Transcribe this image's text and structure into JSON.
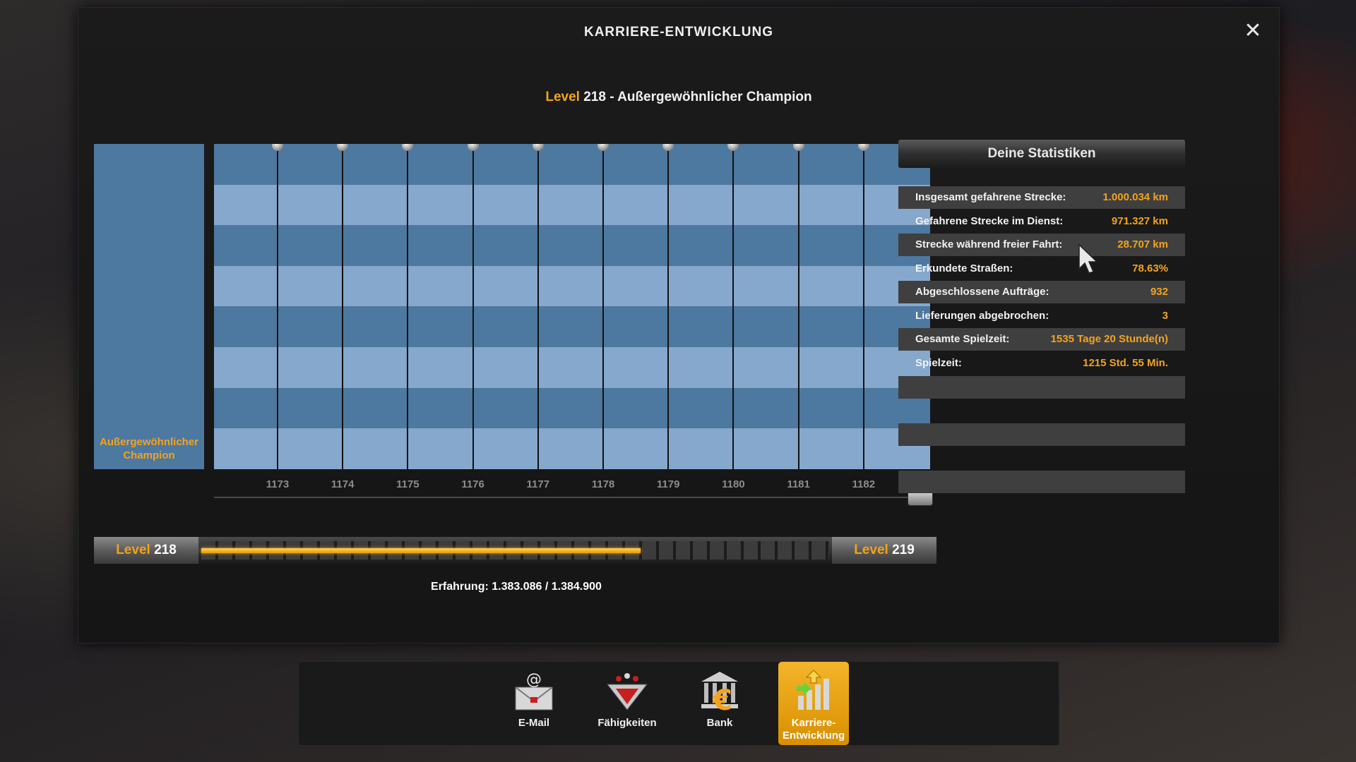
{
  "window": {
    "title": "KARRIERE-ENTWICKLUNG",
    "close_symbol": "✕"
  },
  "heading": {
    "level_word": "Level",
    "level_rest": " 218 - Außergewöhnlicher Champion"
  },
  "rank": {
    "label": "Außergewöhnlicher Champion"
  },
  "timeline": {
    "ticks": [
      "1173",
      "1174",
      "1175",
      "1176",
      "1177",
      "1178",
      "1179",
      "1180",
      "1181",
      "1182"
    ]
  },
  "xp_bar": {
    "left_level_word": "Level",
    "left_level_num": " 218",
    "right_level_word": "Level",
    "right_level_num": " 219",
    "progress": 0.7,
    "text": "Erfahrung: 1.383.086 / 1.384.900"
  },
  "stats": {
    "header": "Deine Statistiken",
    "rows": [
      {
        "label": "Insgesamt gefahrene Strecke:",
        "value": "1.000.034 km"
      },
      {
        "label": "Gefahrene Strecke im Dienst:",
        "value": "971.327 km"
      },
      {
        "label": "Strecke während freier Fahrt:",
        "value": "28.707 km"
      },
      {
        "label": "Erkundete Straßen:",
        "value": "78.63%"
      },
      {
        "label": "Abgeschlossene Aufträge:",
        "value": "932"
      },
      {
        "label": "Lieferungen abgebrochen:",
        "value": "3"
      },
      {
        "label": "Gesamte Spielzeit:",
        "value": "1535 Tage 20 Stunde(n)"
      },
      {
        "label": "Spielzeit:",
        "value": "1215 Std. 55 Min."
      }
    ]
  },
  "dock": {
    "items": [
      {
        "label": "E-Mail",
        "icon": "email-icon"
      },
      {
        "label": "Fähigkeiten",
        "icon": "skills-icon"
      },
      {
        "label": "Bank",
        "icon": "bank-icon"
      },
      {
        "label": "Karriere-\nEntwicklung",
        "icon": "career-icon"
      }
    ]
  },
  "colors": {
    "accent": "#f3a31c",
    "chart_dark": "#4d78a0",
    "chart_light": "#86a8cd"
  }
}
